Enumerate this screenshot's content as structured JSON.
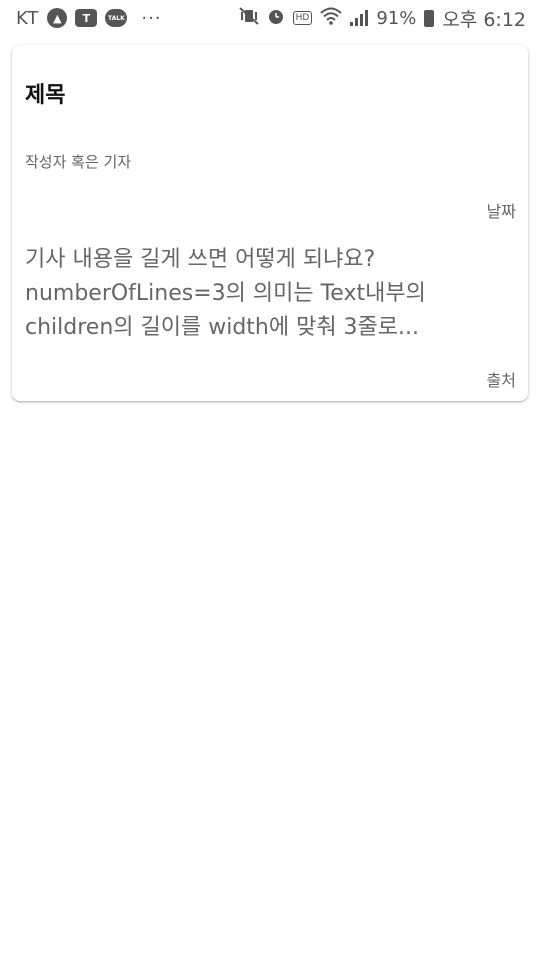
{
  "status_bar": {
    "carrier": "KT",
    "icons": [
      "navigation-icon",
      "teams-icon",
      "kakaotalk-icon",
      "more-notifications-icon",
      "mute-vibrate-icon",
      "alarm-icon",
      "hd-icon",
      "wifi-icon",
      "signal-icon",
      "battery-icon"
    ],
    "teams_label": "T",
    "talk_label": "TALK",
    "more": "···",
    "hd": "HD",
    "battery": "91%",
    "time": "오후 6:12"
  },
  "card": {
    "title": "제목",
    "author": "작성자 혹은 기자",
    "date": "날짜",
    "body": "기사 내용을 길게 쓰면 어떻게 되냐요? numberOfLines=3의 의미는 Text내부의 children의 길이를 width에 맞춰 3줄로...",
    "source": "출처"
  }
}
